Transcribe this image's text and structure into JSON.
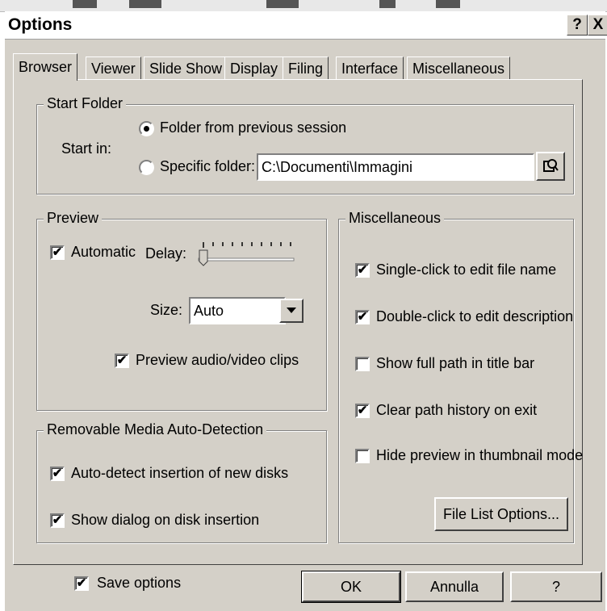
{
  "window": {
    "title": "Options",
    "help_btn": "?",
    "close_btn": "X"
  },
  "tabs": [
    "Browser",
    "Viewer",
    "Slide Show",
    "Display",
    "Filing",
    "Interface",
    "Miscellaneous"
  ],
  "start_folder": {
    "legend": "Start Folder",
    "start_in_label": "Start in:",
    "option_previous": "Folder from previous session",
    "option_specific": "Specific folder:",
    "folder_path": "C:\\Documenti\\Immagini"
  },
  "preview": {
    "legend": "Preview",
    "automatic": "Automatic",
    "delay": "Delay:",
    "size": "Size:",
    "size_value": "Auto",
    "audio_video": "Preview audio/video clips"
  },
  "removable": {
    "legend": "Removable Media Auto-Detection",
    "auto_detect": "Auto-detect insertion of new disks",
    "show_dialog": "Show dialog on disk insertion"
  },
  "misc": {
    "legend": "Miscellaneous",
    "single_click": "Single-click to edit file name",
    "double_click": "Double-click to edit description",
    "full_path": "Show full path in title bar",
    "clear_history": "Clear path history on exit",
    "hide_preview": "Hide preview in thumbnail mode",
    "file_list_btn": "File List Options..."
  },
  "footer": {
    "save_options": "Save options",
    "ok": "OK",
    "cancel": "Annulla",
    "help": "?"
  }
}
